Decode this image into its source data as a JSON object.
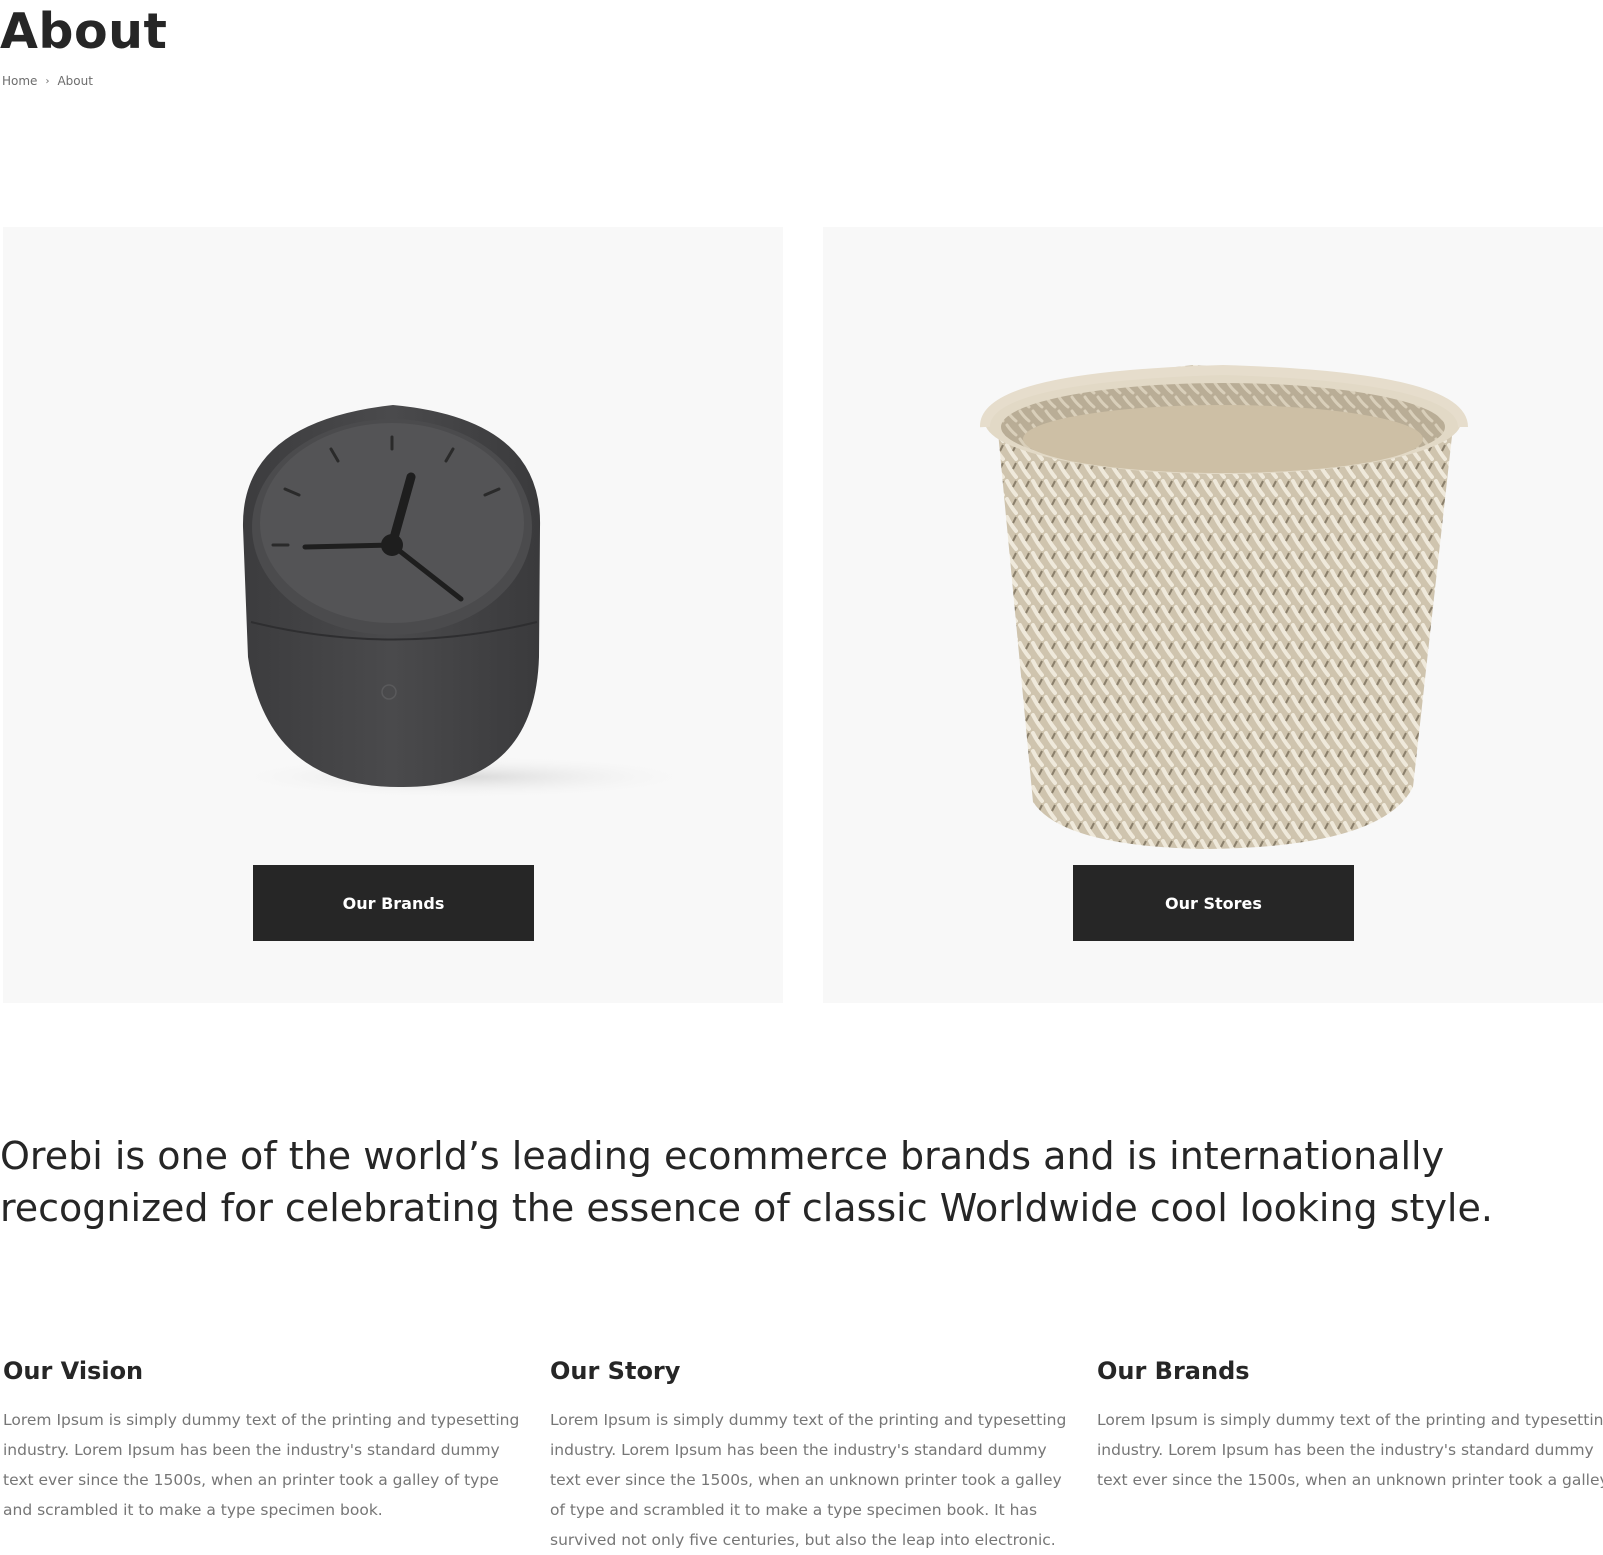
{
  "page": {
    "title": "About",
    "breadcrumb": {
      "home": "Home",
      "separator": "›",
      "current": "About"
    }
  },
  "cards": [
    {
      "image": "desk-clock",
      "button_label": "Our Brands"
    },
    {
      "image": "woven-basket",
      "button_label": "Our Stores"
    }
  ],
  "tagline": "Orebi is one of the world’s leading ecommerce brands and is internationally recognized for celebrating the essence of classic Worldwide cool looking style.",
  "columns": [
    {
      "heading": "Our Vision",
      "text": "Lorem Ipsum is simply dummy text of the printing and typesetting industry. Lorem Ipsum has been the industry's standard dummy text ever since the 1500s, when an  printer took a galley of type and scrambled it to make a type specimen book."
    },
    {
      "heading": "Our Story",
      "text": "Lorem Ipsum is simply dummy text of the printing and typesetting industry. Lorem Ipsum has been the industry's standard dummy text ever since the 1500s, when an unknown printer took a galley of type and scrambled it to make a type specimen book. It has survived not only five centuries, but also the leap into electronic."
    },
    {
      "heading": "Our Brands",
      "text": "Lorem Ipsum is simply dummy text of the printing and typesetting industry. Lorem Ipsum has been the industry's standard dummy text ever since the 1500s, when an unknown printer took a galley."
    }
  ],
  "colors": {
    "dark": "#262626",
    "card_bg": "#f8f8f8",
    "muted_text": "#767676"
  }
}
